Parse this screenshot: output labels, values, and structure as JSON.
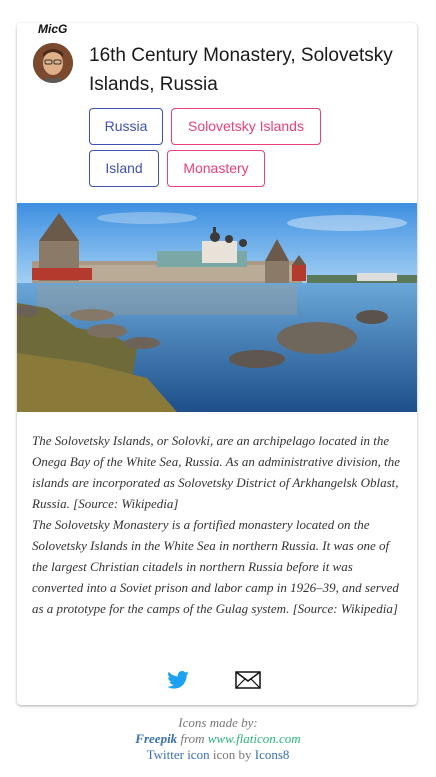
{
  "author": {
    "name": "MicG"
  },
  "post": {
    "title": "16th Century Monastery, Solovetsky Islands, Russia",
    "tags": [
      "Russia",
      "Solovetsky Islands",
      "Island",
      "Monastery"
    ],
    "description": [
      "The Solovetsky Islands, or Solovki, are an archipelago located in the Onega Bay of the White Sea, Russia. As an administrative division, the islands are incorporated as Solovetsky District of Arkhangelsk Oblast, Russia. [Source: Wikipedia]",
      "The Solovetsky Monastery is a fortified monastery located on the Solovetsky Islands in the White Sea in northern Russia. It was one of the largest Christian citadels in northern Russia before it was converted into a Soviet prison and labor camp in 1926–39, and served as a prototype for the camps of the Gulag system. [Source: Wikipedia]"
    ]
  },
  "share": {
    "icons": [
      "twitter-icon",
      "mail-icon"
    ]
  },
  "credits": {
    "line1": "Icons made by:",
    "freepik": "Freepik",
    "from": "from",
    "flaticon": "www.flaticon.com",
    "twitter_icon": "Twitter icon",
    "icon_by": "icon by",
    "icons8": "Icons8"
  },
  "colors": {
    "tag_blue": "#3f51b5",
    "tag_pink": "#e9407a",
    "twitter": "#1da1f2",
    "flaticon_green": "#2ab27b"
  }
}
